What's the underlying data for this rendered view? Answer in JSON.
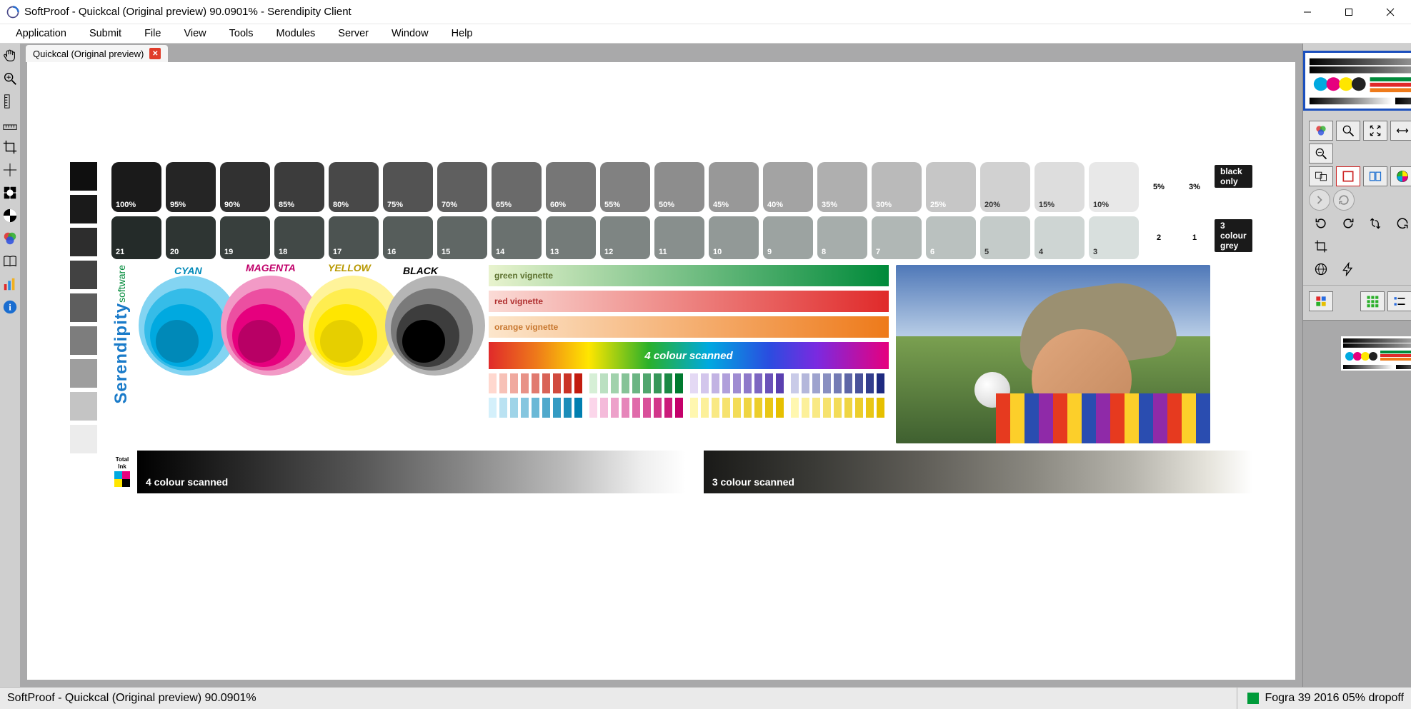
{
  "window": {
    "title": "SoftProof - Quickcal (Original preview) 90.0901% - Serendipity Client"
  },
  "menubar": [
    "Application",
    "Submit",
    "File",
    "View",
    "Tools",
    "Modules",
    "Server",
    "Window",
    "Help"
  ],
  "tab": {
    "label": "Quickcal (Original preview)"
  },
  "left_tools": [
    "hand",
    "zoom",
    "ruler-v",
    "ruler-h",
    "crop",
    "crosshair",
    "grid-a",
    "grid-b",
    "color",
    "book",
    "bars",
    "info"
  ],
  "chart": {
    "black_only_label": "black only",
    "three_colour_grey_label": "3 colour grey",
    "row1_percents": [
      "100%",
      "95%",
      "90%",
      "85%",
      "80%",
      "75%",
      "70%",
      "65%",
      "60%",
      "55%",
      "50%",
      "45%",
      "40%",
      "35%",
      "30%",
      "25%",
      "20%",
      "15%",
      "10%",
      "5%",
      "3%"
    ],
    "row2_labels": [
      "21",
      "20",
      "19",
      "18",
      "17",
      "16",
      "15",
      "14",
      "13",
      "12",
      "11",
      "10",
      "9",
      "8",
      "7",
      "6",
      "5",
      "4",
      "3",
      "2",
      "1"
    ],
    "brand_main": "Serendipity",
    "brand_sub": "software",
    "cmyk_labels": {
      "c": "CYAN",
      "m": "MAGENTA",
      "y": "YELLOW",
      "k": "BLACK"
    },
    "vignettes": {
      "green": "green vignette",
      "red": "red vignette",
      "orange": "orange vignette",
      "scanned": "4 colour scanned"
    },
    "bottom": {
      "left": "4 colour scanned",
      "right": "3 colour scanned",
      "total_ink_a": "Total",
      "total_ink_b": "Ink"
    }
  },
  "right_tools_rows": {
    "row1": [
      "channels",
      "zoom-fit",
      "fit-both",
      "fit-width",
      "fit-height",
      "zoom-in",
      "zoom-out"
    ],
    "row2": [
      "compare",
      "red-box",
      "overlay",
      "wheel",
      "percent"
    ],
    "row3": [
      "forward",
      "back"
    ],
    "row4": [
      "rotate-cw",
      "rotate-ccw",
      "loop",
      "undo",
      "contrast",
      "columns",
      "crop2"
    ],
    "row5": [
      "globe",
      "lightning"
    ],
    "row6": [
      "view-a",
      "view-b",
      "view-c"
    ]
  },
  "statusbar": {
    "left": "SoftProof - Quickcal (Original preview) 90.0901%",
    "right": "Fogra 39 2016 05% dropoff"
  },
  "colors": {
    "cyan": "#00a9e0",
    "magenta": "#e6007e",
    "yellow": "#ffe600",
    "black": "#1a1a1a",
    "green_vig_from": "#e8f3ce",
    "green_vig_to": "#008a3a",
    "red_vig_from": "#fadbd6",
    "red_vig_to": "#e02a2a",
    "orange_vig_from": "#fce6cc",
    "orange_vig_to": "#ee7a1a"
  }
}
